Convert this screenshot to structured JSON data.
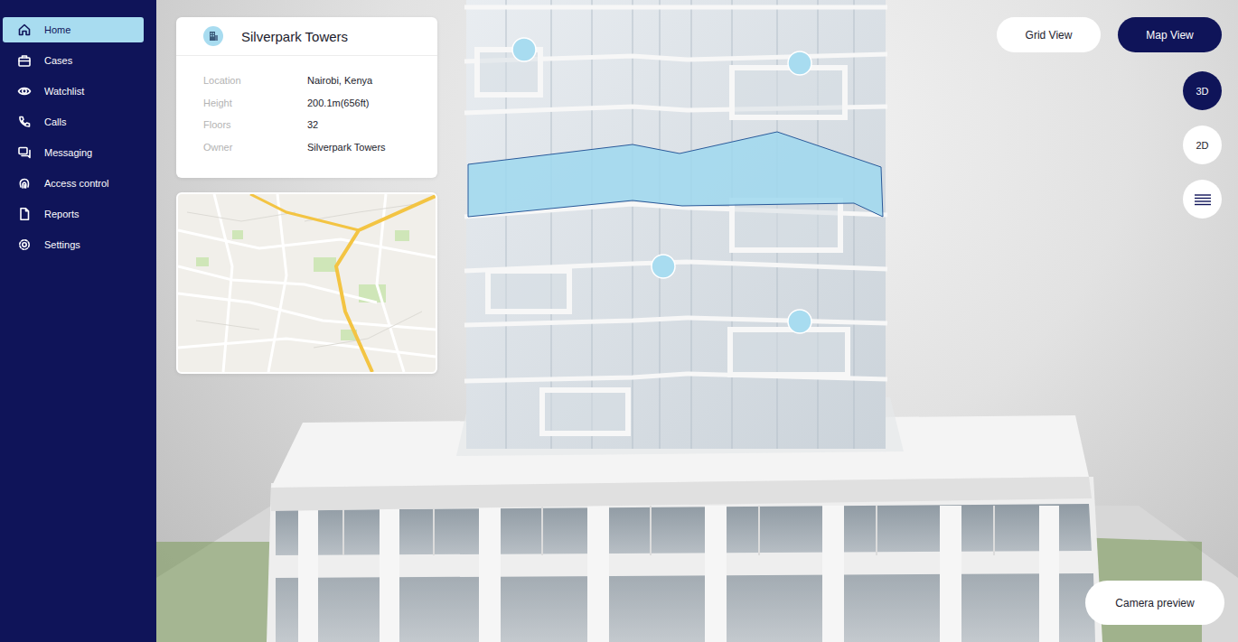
{
  "sidebar": {
    "items": [
      {
        "label": "Home",
        "selected": true
      },
      {
        "label": "Cases",
        "selected": false
      },
      {
        "label": "Watchlist",
        "selected": false
      },
      {
        "label": "Calls",
        "selected": false
      },
      {
        "label": "Messaging",
        "selected": false
      },
      {
        "label": "Access control",
        "selected": false
      },
      {
        "label": "Reports",
        "selected": false
      },
      {
        "label": "Settings",
        "selected": false
      }
    ]
  },
  "building": {
    "name": "Silverpark Towers",
    "details": [
      {
        "label": "Location",
        "value": "Nairobi, Kenya"
      },
      {
        "label": "Height",
        "value": "200.1m(656ft)"
      },
      {
        "label": "Floors",
        "value": "32"
      },
      {
        "label": "Owner",
        "value": "Silverpark Towers"
      }
    ]
  },
  "view_toggle": [
    {
      "label": "Grid View",
      "selected": false
    },
    {
      "label": "Map View",
      "selected": true
    }
  ],
  "modes": [
    {
      "label": "3D",
      "selected": true
    },
    {
      "label": "2D",
      "selected": false
    }
  ],
  "camera_preview": {
    "label": "Camera preview"
  }
}
